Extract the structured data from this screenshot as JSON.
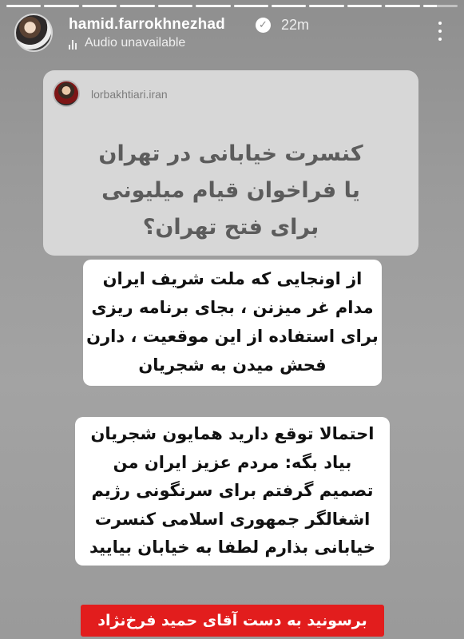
{
  "story": {
    "progress": [
      1,
      1,
      1,
      1,
      1,
      1,
      1,
      1,
      1,
      1,
      1,
      0.4
    ]
  },
  "header": {
    "username": "hamid.farrokhnezhad",
    "verified_icon": "verified-check-icon",
    "time": "22m",
    "audio_status": "Audio unavailable",
    "more_icon": "more-options-icon"
  },
  "card": {
    "username": "lorbakhtiari.iran",
    "title_lines": [
      "کنسرت خیابانی در تهران",
      "یا فراخوان قیام میلیونی",
      "برای فتح تهران؟"
    ]
  },
  "block1": {
    "lines": [
      "از اونجایی که ملت شریف ایران",
      "مدام غر میزنن ، بجای برنامه ریزی",
      "برای استفاده از این موقعیت ، دارن",
      "فحش میدن به شجریان"
    ]
  },
  "block2": {
    "lines": [
      "احتمالا توقع دارید همایون شجریان",
      "بیاد بگه: مردم عزیز ایران من",
      "تصمیم گرفتم برای سرنگونی رژیم",
      "اشغالگر جمهوری اسلامی کنسرت",
      "خیابانی بذارم لطفا به خیابان بیایید"
    ]
  },
  "banner": {
    "text": "برسونید به دست آقای حمید فرخ‌نژاد",
    "color": "#e21d1d"
  }
}
